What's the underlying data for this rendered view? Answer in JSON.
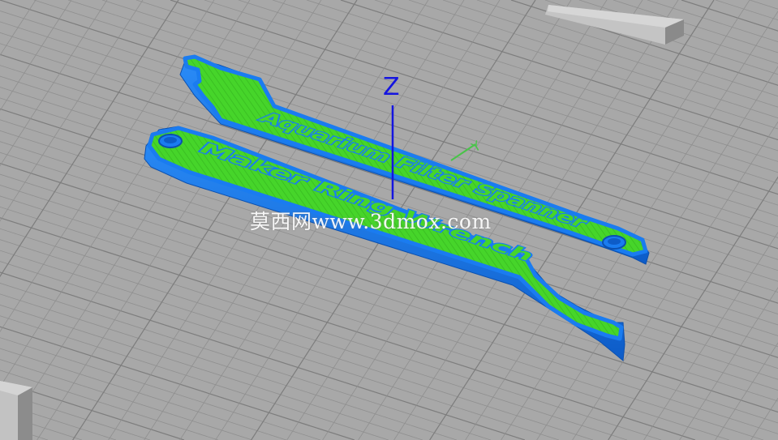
{
  "viewport": {
    "background_color": "#a8a8a8",
    "grid_color": "#8f8f8f",
    "grid_major_color": "#7d7d7d"
  },
  "axes": {
    "z_label": "Z",
    "z_color": "#1515e0",
    "y_label": "Y",
    "y_color": "#49c449"
  },
  "model": {
    "wall_color": "#1a7cf0",
    "wall_dark_color": "#0f5dc4",
    "infill_color": "#46d52a",
    "top_text_front": "Maker Ring Wrench",
    "top_text_back": "Aquarium Filter Spanner"
  },
  "watermark": {
    "text": "莫西网www.3dmox.com"
  }
}
